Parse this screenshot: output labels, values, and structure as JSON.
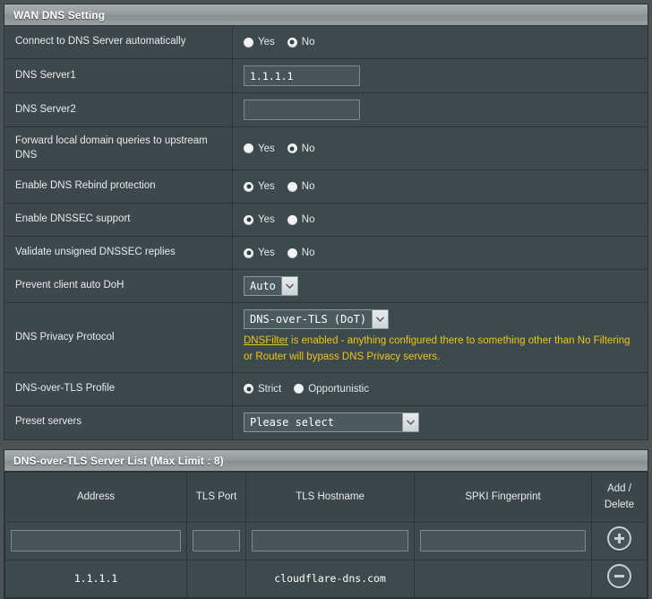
{
  "wan_dns_panel": {
    "title": "WAN DNS Setting",
    "rows": [
      {
        "label": "Connect to DNS Server automatically",
        "type": "radio",
        "options": [
          {
            "label": "Yes",
            "checked": false
          },
          {
            "label": "No",
            "checked": true
          }
        ]
      },
      {
        "label": "DNS Server1",
        "type": "input",
        "value": "1.1.1.1",
        "placeholder": ""
      },
      {
        "label": "DNS Server2",
        "type": "input",
        "value": "",
        "placeholder": ""
      },
      {
        "label": "Forward local domain queries to upstream DNS",
        "type": "radio",
        "options": [
          {
            "label": "Yes",
            "checked": false
          },
          {
            "label": "No",
            "checked": true
          }
        ]
      },
      {
        "label": "Enable DNS Rebind protection",
        "type": "radio",
        "options": [
          {
            "label": "Yes",
            "checked": true
          },
          {
            "label": "No",
            "checked": false
          }
        ]
      },
      {
        "label": "Enable DNSSEC support",
        "type": "radio",
        "options": [
          {
            "label": "Yes",
            "checked": true
          },
          {
            "label": "No",
            "checked": false
          }
        ]
      },
      {
        "label": "Validate unsigned DNSSEC replies",
        "type": "radio",
        "options": [
          {
            "label": "Yes",
            "checked": true
          },
          {
            "label": "No",
            "checked": false
          }
        ]
      },
      {
        "label": "Prevent client auto DoH",
        "type": "select",
        "value": "Auto"
      },
      {
        "label": "DNS Privacy Protocol",
        "type": "select-note",
        "value": "DNS-over-TLS (DoT)",
        "note_link": "DNSFilter",
        "note_text": " is enabled - anything configured there to something other than No Filtering or Router will bypass DNS Privacy servers."
      },
      {
        "label": "DNS-over-TLS Profile",
        "type": "radio",
        "options": [
          {
            "label": "Strict",
            "checked": true
          },
          {
            "label": "Opportunistic",
            "checked": false
          }
        ]
      },
      {
        "label": "Preset servers",
        "type": "select",
        "value": "Please select"
      }
    ]
  },
  "server_list_panel": {
    "title": "DNS-over-TLS Server List (Max Limit : 8)",
    "columns": [
      "Address",
      "TLS Port",
      "TLS Hostname",
      "SPKI Fingerprint",
      "Add / Delete"
    ],
    "add_column_line1": "Add /",
    "add_column_line2": "Delete",
    "new_row": {
      "address": "",
      "tls_port": "",
      "tls_hostname": "",
      "spki_fingerprint": "",
      "action_icon": "plus-icon"
    },
    "rows": [
      {
        "address": "1.1.1.1",
        "tls_port": "",
        "tls_hostname": "cloudflare-dns.com",
        "spki_fingerprint": "",
        "action_icon": "minus-icon"
      }
    ]
  },
  "colors": {
    "page_bg": "#4b5356",
    "panel_bg": "#3d4a4d",
    "row_border": "#2b3436",
    "header_grad_top": "#a7adb0",
    "header_grad_bottom": "#9aa1a4",
    "warning_yellow": "#f0c419",
    "text": "#ffffff"
  }
}
